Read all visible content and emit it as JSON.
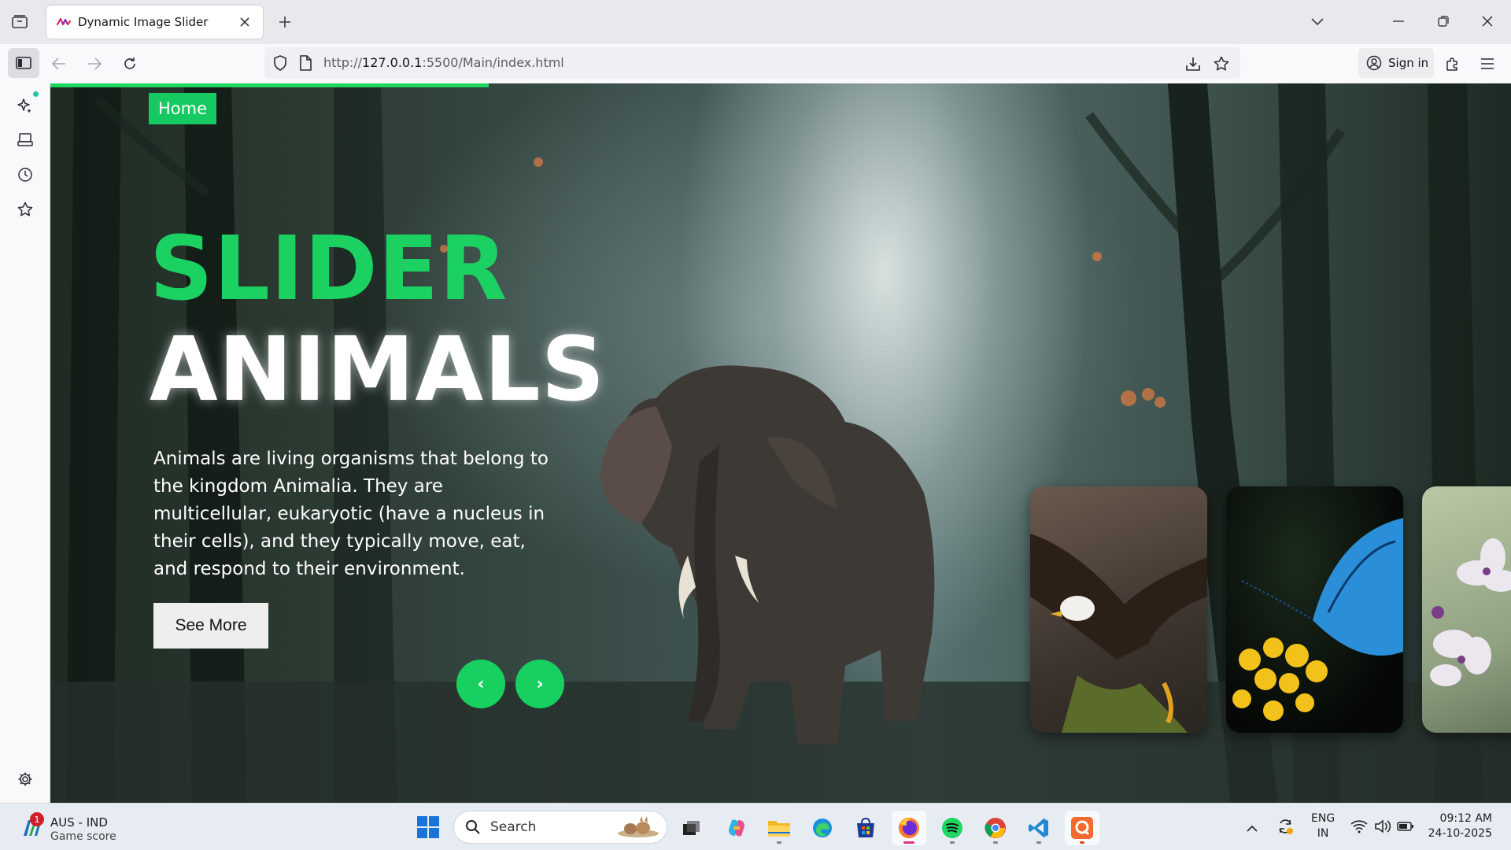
{
  "browser": {
    "tab_title": "Dynamic Image Slider",
    "url_prefix": "http://",
    "url_host": "127.0.0.1",
    "url_rest": ":5500/Main/index.html",
    "sign_in_label": "Sign in"
  },
  "page": {
    "home_label": "Home",
    "title_line1": "SLIDER",
    "title_line2": "ANIMALS",
    "description": "Animals are living organisms that belong to the kingdom Animalia. They are multicellular, eukaryotic (have a nucleus in their cells), and they typically move, eat, and respond to their environment.",
    "see_more_label": "See More",
    "prev_label": "‹",
    "next_label": "›",
    "progress_fraction": 0.3,
    "accent_color": "#1ed760",
    "thumbnails": [
      "eagle",
      "blue butterfly on yellow flowers",
      "white blossoms"
    ]
  },
  "taskbar": {
    "weather_title": "AUS - IND",
    "weather_subtitle": "Game score",
    "notification_count": "1",
    "search_placeholder": "Search",
    "lang_line1": "ENG",
    "lang_line2": "IN",
    "time": "09:12 AM",
    "date": "24-10-2025"
  },
  "icons": {
    "sidebar": [
      "sidebar-toggle-icon",
      "ai-sparkle-icon",
      "synced-tabs-icon",
      "history-icon",
      "bookmarks-icon",
      "settings-icon"
    ],
    "taskbar": [
      "windows-start-icon",
      "search-icon",
      "task-view-icon",
      "copilot-icon",
      "file-explorer-icon",
      "edge-icon",
      "store-icon",
      "firefox-icon",
      "spotify-icon",
      "chrome-icon",
      "vscode-icon",
      "quickshare-icon"
    ]
  }
}
